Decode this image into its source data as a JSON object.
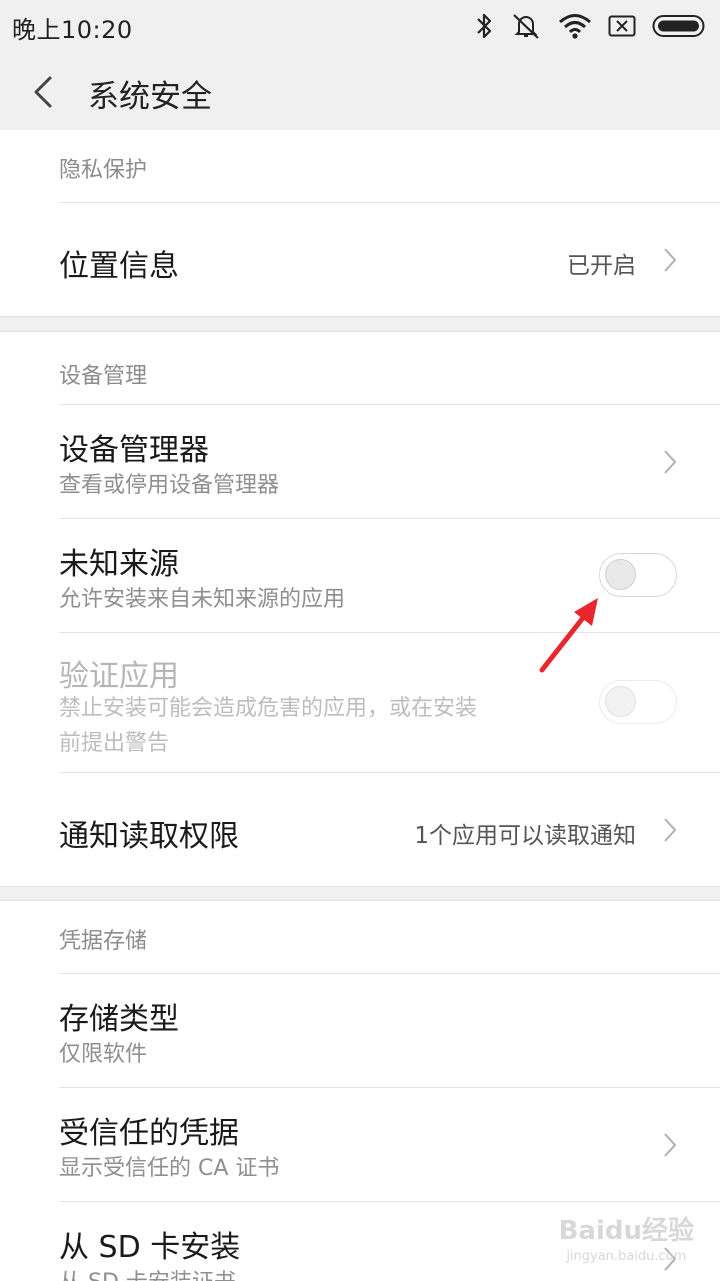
{
  "status_bar": {
    "time": "晚上10:20",
    "icons": [
      "bluetooth-icon",
      "mute-vibrate-icon",
      "wifi-icon",
      "no-sim-icon",
      "battery-icon"
    ]
  },
  "header": {
    "title": "系统安全",
    "back_icon": "chevron-left-icon"
  },
  "privacy": {
    "header": "隐私保护",
    "location": {
      "title": "位置信息",
      "value": "已开启"
    }
  },
  "device": {
    "header": "设备管理",
    "device_admin": {
      "title": "设备管理器",
      "subtitle": "查看或停用设备管理器"
    },
    "unknown_sources": {
      "title": "未知来源",
      "subtitle": "允许安装来自未知来源的应用",
      "enabled": false
    },
    "verify_apps": {
      "title": "验证应用",
      "subtitle_line1": "禁止安装可能会造成危害的应用，或在安装",
      "subtitle_line2": "前提出警告",
      "enabled": false,
      "disabled": true
    },
    "notification_access": {
      "title": "通知读取权限",
      "value": "1个应用可以读取通知"
    }
  },
  "credentials": {
    "header": "凭据存储",
    "storage_type": {
      "title": "存储类型",
      "subtitle": "仅限软件"
    },
    "trusted": {
      "title": "受信任的凭据",
      "subtitle": "显示受信任的 CA 证书"
    },
    "install_sd": {
      "title": "从 SD 卡安装",
      "subtitle": "从 SD 卡安装证书"
    }
  },
  "annotation": {
    "arrow_color": "#e8262b"
  },
  "watermark": {
    "logo": "Baidu经验",
    "url": "jingyan.baidu.com"
  }
}
